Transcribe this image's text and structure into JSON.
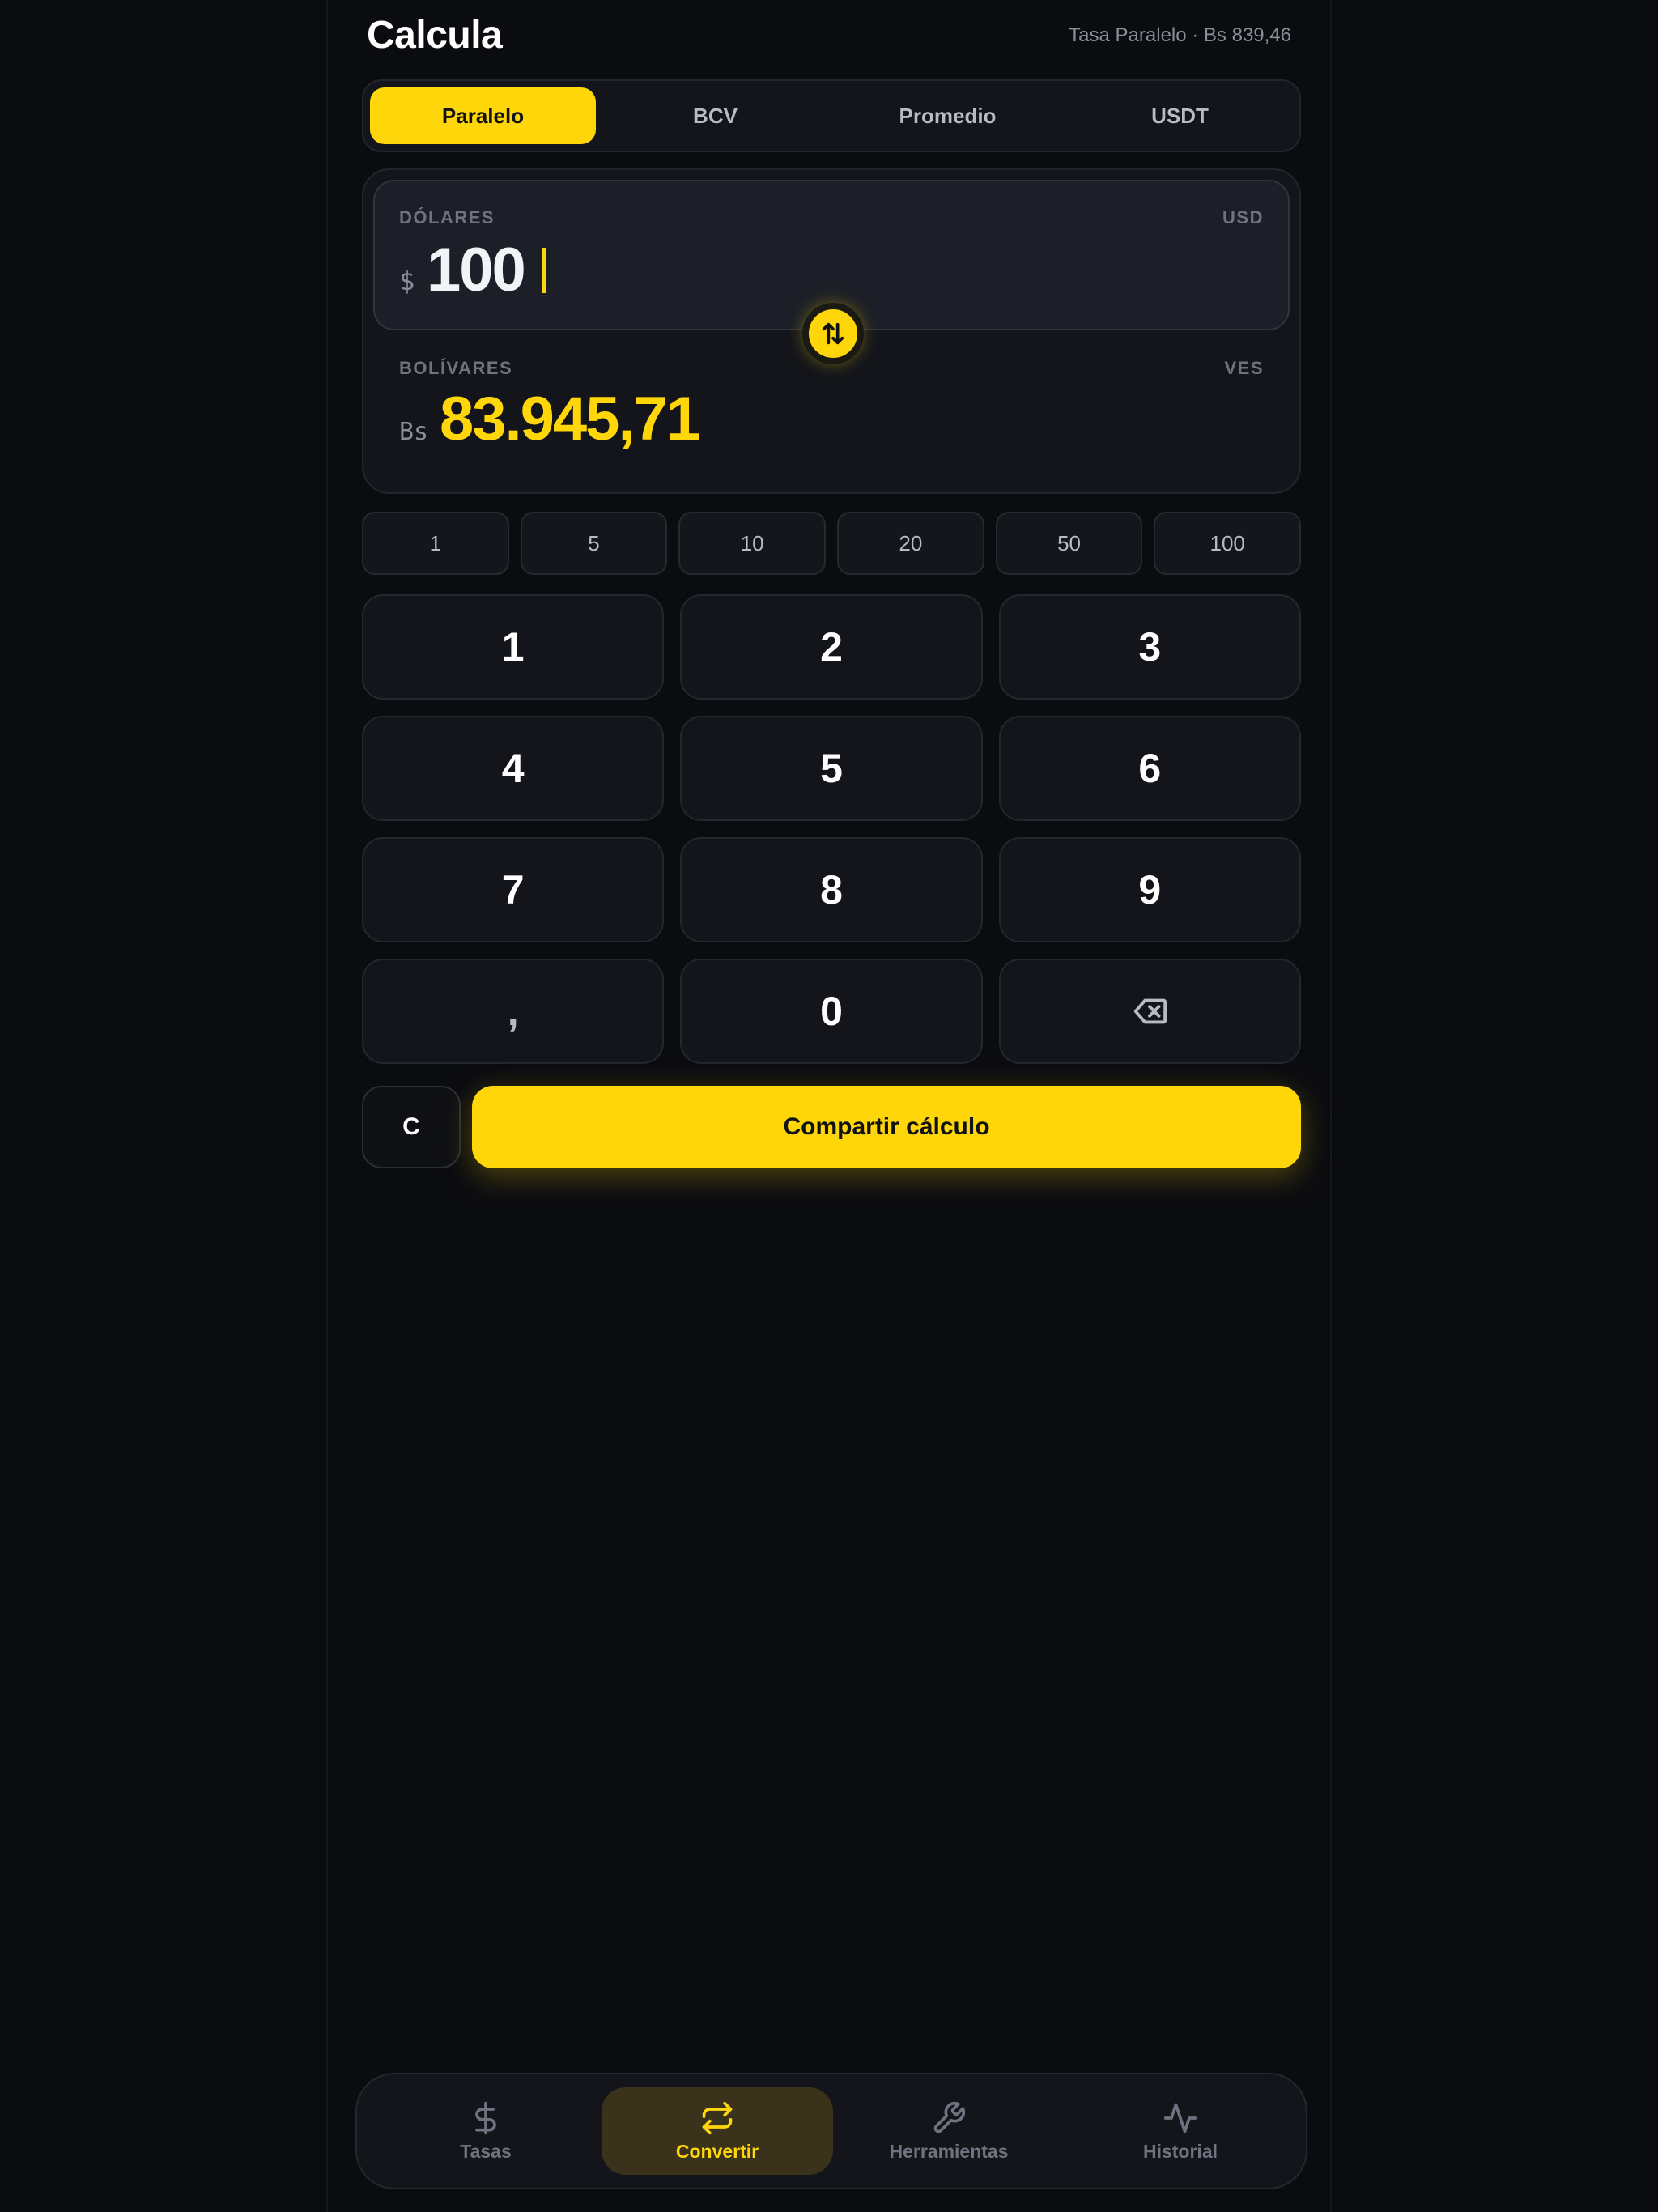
{
  "header": {
    "title": "Calcula",
    "rate_label": "Tasa Paralelo · Bs 839,46"
  },
  "tabs": [
    {
      "label": "Paralelo",
      "active": true
    },
    {
      "label": "BCV",
      "active": false
    },
    {
      "label": "Promedio",
      "active": false
    },
    {
      "label": "USDT",
      "active": false
    }
  ],
  "converter": {
    "from": {
      "label": "DÓLARES",
      "code": "USD",
      "symbol": "$",
      "amount": "100"
    },
    "to": {
      "label": "BOLÍVARES",
      "code": "VES",
      "symbol": "Bs",
      "amount": "83.945,71"
    },
    "swap_icon": "swap-vertical-icon"
  },
  "quick_amounts": [
    "1",
    "5",
    "10",
    "20",
    "50",
    "100"
  ],
  "keypad": {
    "keys": [
      "1",
      "2",
      "3",
      "4",
      "5",
      "6",
      "7",
      "8",
      "9",
      ",",
      "0"
    ],
    "backspace_icon": "backspace-icon"
  },
  "actions": {
    "clear_label": "C",
    "share_label": "Compartir cálculo"
  },
  "nav": [
    {
      "label": "Tasas",
      "icon": "dollar-icon",
      "active": false
    },
    {
      "label": "Convertir",
      "icon": "repeat-icon",
      "active": true
    },
    {
      "label": "Herramientas",
      "icon": "wrench-icon",
      "active": false
    },
    {
      "label": "Historial",
      "icon": "activity-icon",
      "active": false
    }
  ],
  "colors": {
    "accent": "#ffd60a",
    "background": "#0b0c10",
    "surface": "#13151b"
  }
}
